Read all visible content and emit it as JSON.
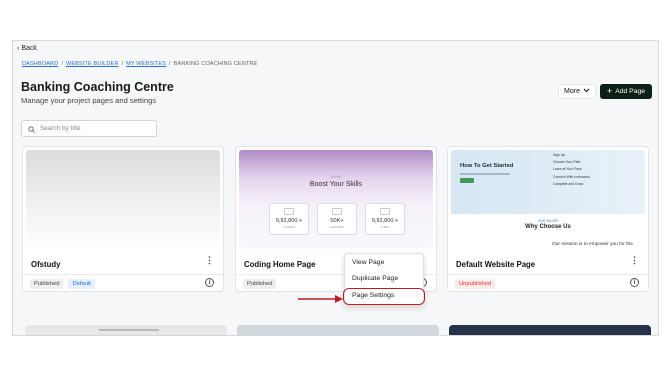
{
  "nav": {
    "back_label": "Back"
  },
  "breadcrumbs": [
    "DASHBOARD",
    "WEBSITE BUILDER",
    "MY WEBSITES",
    "BANKING COACHING CENTRE"
  ],
  "breadcrumb_sep": "/",
  "header": {
    "title": "Banking Coaching Centre",
    "subtitle": "Manage your project pages and settings",
    "more_label": "More",
    "add_label": "Add Page"
  },
  "search": {
    "placeholder": "Search by title"
  },
  "cards": [
    {
      "name": "Ofstudy",
      "status": "Published",
      "tag": "Default"
    },
    {
      "name": "Coding Home Page",
      "status": "Published",
      "preview": {
        "logo": "ROSE",
        "heading": "Boost Your Skills",
        "stats": [
          {
            "value": "9,92,800 +",
            "label": "STUDENT"
          },
          {
            "value": "50K+",
            "label": "LEARNERS"
          },
          {
            "value": "9,92,800 +",
            "label": "CLIENT"
          }
        ]
      }
    },
    {
      "name": "Default Website Page",
      "status": "Unpublished",
      "preview": {
        "heading": "How To Get Started",
        "steps": [
          "Sign Up",
          "Choose Your Path",
          "Learn at Your Pace",
          "Connect With Instructors",
          "Complete and Grow"
        ],
        "section_tag": "OUR VALUES",
        "section_title": "Why Choose Us",
        "cut_text": "Our mission is to empower you for the"
      }
    }
  ],
  "context_menu": {
    "items": [
      "View Page",
      "Duplicate Page",
      "Page Settings"
    ]
  },
  "colors": {
    "accent_dark": "#0d1f17",
    "link": "#2b6fd6",
    "highlight": "#b42025",
    "unpublished": "#dd3333"
  }
}
